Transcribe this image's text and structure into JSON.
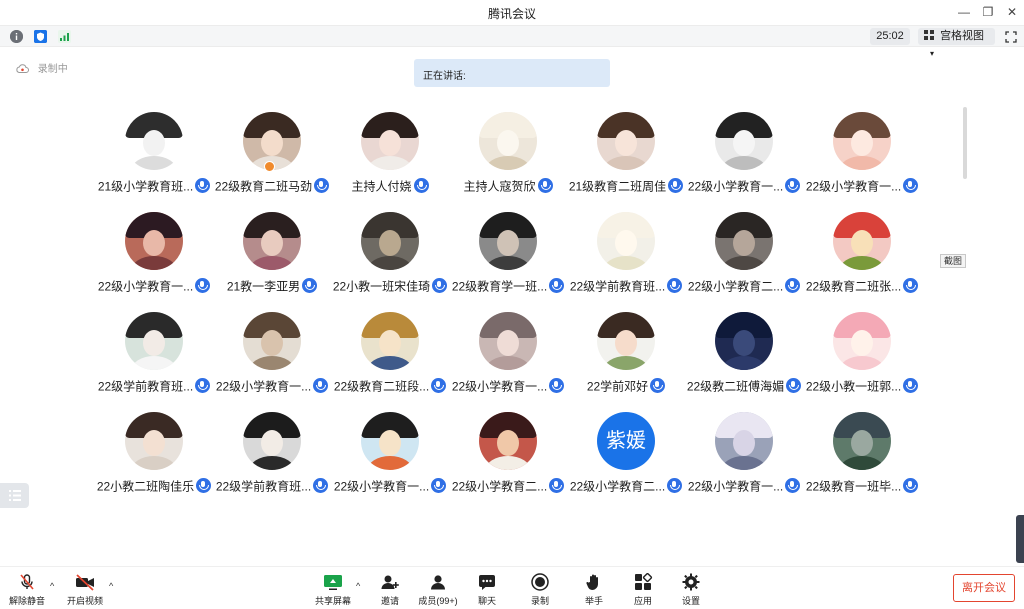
{
  "window": {
    "title": "腾讯会议",
    "minimize": "—",
    "restore": "❐",
    "close": "✕"
  },
  "infobar": {
    "timer": "25:02",
    "view_mode": "宫格视图",
    "view_caret": "▾",
    "icons": [
      "info-icon",
      "shield-icon",
      "signal-icon",
      "grid-view-icon",
      "fullscreen-icon"
    ]
  },
  "recording_status": "录制中",
  "speaking_label": "正在讲话:",
  "screenshot_tag": "截图",
  "participants": [
    {
      "name": "21级小学教育班...",
      "avatar_text": "",
      "bg": "#ffffff",
      "hair": "#2d2d2d",
      "face": "#f2f2f2",
      "body": "#dcdcdc"
    },
    {
      "name": "22级教育二班马劲",
      "avatar_text": "",
      "bg": "#cfb9a8",
      "hair": "#3a2a22",
      "face": "#f3dccb",
      "body": "#e8e0d8",
      "host": true
    },
    {
      "name": "主持人付娆",
      "avatar_text": "",
      "bg": "#e9d7d2",
      "hair": "#2b1f1c",
      "face": "#f6e1d8",
      "body": "#f0ece8"
    },
    {
      "name": "主持人寇贺欣",
      "avatar_text": "",
      "bg": "#ede6da",
      "hair": "#f5efe3",
      "face": "#fbf7ef",
      "body": "#d8cbb4"
    },
    {
      "name": "21级教育二班周佳",
      "avatar_text": "",
      "bg": "#e8d8d0",
      "hair": "#4a3326",
      "face": "#f7e4d9",
      "body": "#d9c5b8"
    },
    {
      "name": "22级小学教育一...",
      "avatar_text": "",
      "bg": "#e9e9e9",
      "hair": "#222222",
      "face": "#f5f5f5",
      "body": "#bdbdbd"
    },
    {
      "name": "22级小学教育一...",
      "avatar_text": "",
      "bg": "#f6d2c8",
      "hair": "#6a4a3a",
      "face": "#fde9e0",
      "body": "#f1b9a9"
    },
    {
      "name": "22级小学教育一...",
      "avatar_text": "",
      "bg": "#b96a5a",
      "hair": "#2c1a22",
      "face": "#e8b8a8",
      "body": "#7a3b3b"
    },
    {
      "name": "21教一李亚男",
      "avatar_text": "",
      "bg": "#b58c8c",
      "hair": "#2a1f1f",
      "face": "#e8cbbf",
      "body": "#9c5a6a"
    },
    {
      "name": "22小教一班宋佳琦",
      "avatar_text": "",
      "bg": "#6e6a63",
      "hair": "#3a3530",
      "face": "#b9a88f",
      "body": "#4a4540"
    },
    {
      "name": "22级教育学一班...",
      "avatar_text": "",
      "bg": "#8a8a8a",
      "hair": "#1e1e1e",
      "face": "#cfc2b6",
      "body": "#3d3d3d"
    },
    {
      "name": "22级学前教育班...",
      "avatar_text": "",
      "bg": "#f2f0e8",
      "hair": "#f7f2e6",
      "face": "#fff9ee",
      "body": "#e6e2c8"
    },
    {
      "name": "22级小学教育二...",
      "avatar_text": "",
      "bg": "#7a7470",
      "hair": "#2a2624",
      "face": "#b5a69a",
      "body": "#4e4844"
    },
    {
      "name": "22级教育二班张...",
      "avatar_text": "",
      "bg": "#f3c9c3",
      "hair": "#d9423a",
      "face": "#f8e0b8",
      "body": "#7a9a3a"
    },
    {
      "name": "22级学前教育班...",
      "avatar_text": "",
      "bg": "#d7e3dc",
      "hair": "#2a2a2a",
      "face": "#f2ebe6",
      "body": "#f5f5f5"
    },
    {
      "name": "22级小学教育一...",
      "avatar_text": "",
      "bg": "#e4ddd3",
      "hair": "#5a4636",
      "face": "#d9c3ad",
      "body": "#9a8670"
    },
    {
      "name": "22级教育二班段...",
      "avatar_text": "",
      "bg": "#e9e2cc",
      "hair": "#b98a3a",
      "face": "#f6e3c8",
      "body": "#3f5a8a"
    },
    {
      "name": "22级小学教育一...",
      "avatar_text": "",
      "bg": "#c9b7b4",
      "hair": "#7a6a6a",
      "face": "#efdcd6",
      "body": "#b39c9a"
    },
    {
      "name": "22学前邓好",
      "avatar_text": "",
      "bg": "#f2f2ee",
      "hair": "#3a2a22",
      "face": "#f6dccb",
      "body": "#8aa56a"
    },
    {
      "name": "22级教二班傅海媚",
      "avatar_text": "",
      "bg": "#1f2a52",
      "hair": "#0f1a3a",
      "face": "#3a4a7a",
      "body": "#2c3a6a"
    },
    {
      "name": "22级小教一班郭...",
      "avatar_text": "",
      "bg": "#fbe6e6",
      "hair": "#f4a9b6",
      "face": "#fff2ea",
      "body": "#f7c9cf"
    },
    {
      "name": "22小教二班陶佳乐",
      "avatar_text": "",
      "bg": "#e8e2dc",
      "hair": "#3a2a24",
      "face": "#f3e0d2",
      "body": "#d9cfc5"
    },
    {
      "name": "22级学前教育班...",
      "avatar_text": "",
      "bg": "#d9d9d9",
      "hair": "#1c1c1c",
      "face": "#f2ece6",
      "body": "#2a2a2a"
    },
    {
      "name": "22级小学教育一...",
      "avatar_text": "",
      "bg": "#cfe6f2",
      "hair": "#1e1e1e",
      "face": "#f6e3c8",
      "body": "#e26a3a"
    },
    {
      "name": "22级小学教育二...",
      "avatar_text": "",
      "bg": "#c4574a",
      "hair": "#3a1a1a",
      "face": "#f0c8a8",
      "body": "#f3eee6"
    },
    {
      "name": "22级小学教育二...",
      "avatar_text": "紫媛",
      "bg": "#1a73e8",
      "hair": "#1a73e8",
      "face": "#1a73e8",
      "body": "#1a73e8"
    },
    {
      "name": "22级小学教育一...",
      "avatar_text": "",
      "bg": "#9aa2b8",
      "hair": "#e9e6f2",
      "face": "#d8d4e6",
      "body": "#6a7290"
    },
    {
      "name": "22级教育一班毕...",
      "avatar_text": "",
      "bg": "#5e7a6a",
      "hair": "#3a4a52",
      "face": "#9aa8a0",
      "body": "#2f4a3a"
    }
  ],
  "toolbar": {
    "unmute": "解除静音",
    "video": "开启视频",
    "share": "共享屏幕",
    "invite": "邀请",
    "members": "成员(99+)",
    "chat": "聊天",
    "record": "录制",
    "raise_hand": "举手",
    "apps": "应用",
    "settings": "设置",
    "leave": "离开会议",
    "caret": "^"
  },
  "colors": {
    "accent": "#2f6fe5",
    "leave": "#e3452f",
    "share_green": "#1aa34a"
  }
}
